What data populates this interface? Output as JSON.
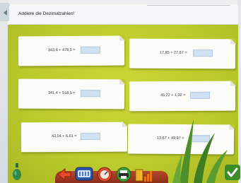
{
  "instruction": {
    "text": "Addiere die Dezimalzahlen!"
  },
  "tasks": [
    {
      "expression": "343,6 + 478,5 =",
      "answer": ""
    },
    {
      "expression": "17,85 + 27,67 =",
      "answer": ""
    },
    {
      "expression": "341,4 + 518,5 =",
      "answer": ""
    },
    {
      "expression": "45,22 + 1,02 =",
      "answer": ""
    },
    {
      "expression": "43,04 + 6,01 =",
      "answer": ""
    },
    {
      "expression": "13,67 + 49,97 =",
      "answer": ""
    }
  ],
  "toolbar": {
    "icons": [
      "back-arrow-icon",
      "calculator-icon",
      "speedometer-icon",
      "printer-icon",
      "statistics-icon"
    ]
  },
  "colors": {
    "board": "#bccb2c",
    "answer_box": "#cfe1f3",
    "toolbar_wood": "#a33c22",
    "check": "#3d8c2a"
  }
}
